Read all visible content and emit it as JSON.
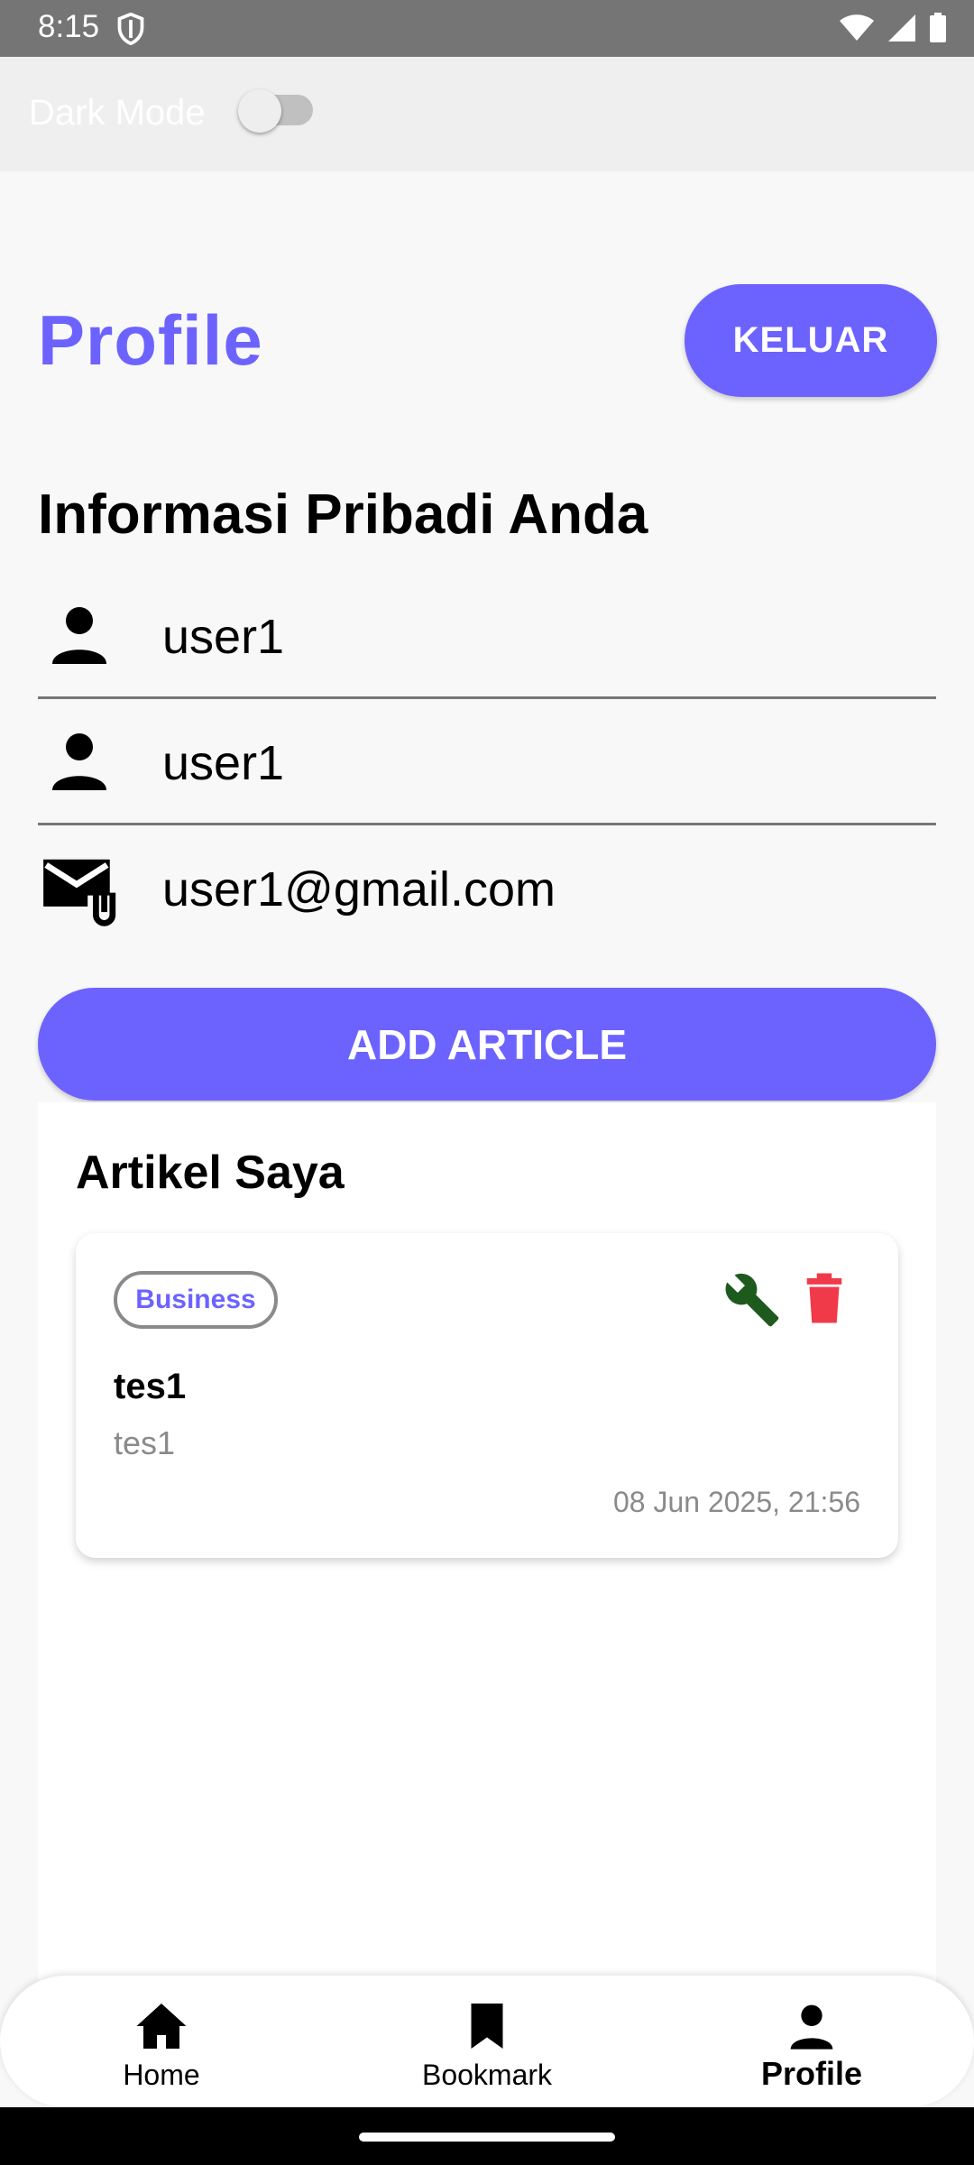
{
  "status_bar": {
    "time": "8:15"
  },
  "dark_mode": {
    "label": "Dark Mode",
    "enabled": false
  },
  "header": {
    "title": "Profile",
    "logout_label": "KELUAR"
  },
  "personal_info": {
    "title": "Informasi Pribadi Anda",
    "fields": [
      {
        "icon": "person-icon",
        "value": "user1"
      },
      {
        "icon": "person-icon",
        "value": "user1"
      },
      {
        "icon": "email-attachment-icon",
        "value": "user1@gmail.com"
      }
    ]
  },
  "add_article_label": "ADD ARTICLE",
  "my_articles": {
    "title": "Artikel Saya",
    "items": [
      {
        "category": "Business",
        "title": "tes1",
        "summary": "tes1",
        "date": "08 Jun 2025, 21:56",
        "edit_icon": "wrench-icon",
        "delete_icon": "trash-icon"
      }
    ]
  },
  "bottom_nav": {
    "items": [
      {
        "label": "Home",
        "icon": "home-icon",
        "active": false
      },
      {
        "label": "Bookmark",
        "icon": "bookmark-icon",
        "active": false
      },
      {
        "label": "Profile",
        "icon": "person-icon",
        "active": true
      }
    ]
  },
  "colors": {
    "accent": "#6c63ff",
    "edit": "#1e5a1e",
    "delete": "#f03a4a"
  }
}
